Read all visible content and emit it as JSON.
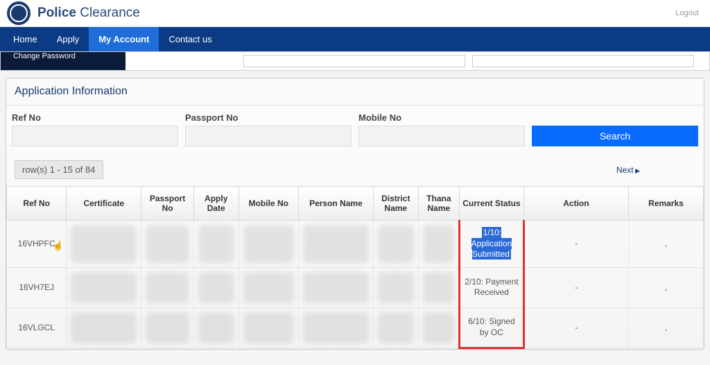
{
  "brand": {
    "strong": "Police",
    "light": "Clearance"
  },
  "header": {
    "logout": "Logout"
  },
  "nav": {
    "items": [
      {
        "label": "Home"
      },
      {
        "label": "Apply"
      },
      {
        "label": "My Account"
      },
      {
        "label": "Contact us"
      }
    ],
    "active_index": 2
  },
  "sidebar": {
    "change_password": "Change Password"
  },
  "panel": {
    "title": "Application Information"
  },
  "search": {
    "refno": {
      "label": "Ref No",
      "value": ""
    },
    "passport": {
      "label": "Passport No",
      "value": ""
    },
    "mobile": {
      "label": "Mobile No",
      "value": ""
    },
    "button": "Search"
  },
  "pager": {
    "rows_text": "row(s) 1 - 15 of 84",
    "next": "Next"
  },
  "table": {
    "headers": {
      "ref": "Ref No",
      "cert": "Certificate",
      "passport": "Passport No",
      "apply": "Apply Date",
      "mobile": "Mobile No",
      "person": "Person Name",
      "district": "District Name",
      "thana": "Thana Name",
      "status": "Current Status",
      "action": "Action",
      "remarks": "Remarks"
    },
    "rows": [
      {
        "ref": "16VHPFC",
        "status": "1/10: Application Submitted",
        "action": "-",
        "remarks": ",",
        "status_selected": true
      },
      {
        "ref": "16VH7EJ",
        "status": "2/10: Payment Received",
        "action": "-",
        "remarks": ",",
        "status_selected": false
      },
      {
        "ref": "16VLGCL",
        "status": "6/10: Signed by OC",
        "action": "-",
        "remarks": ",",
        "status_selected": false
      }
    ]
  }
}
